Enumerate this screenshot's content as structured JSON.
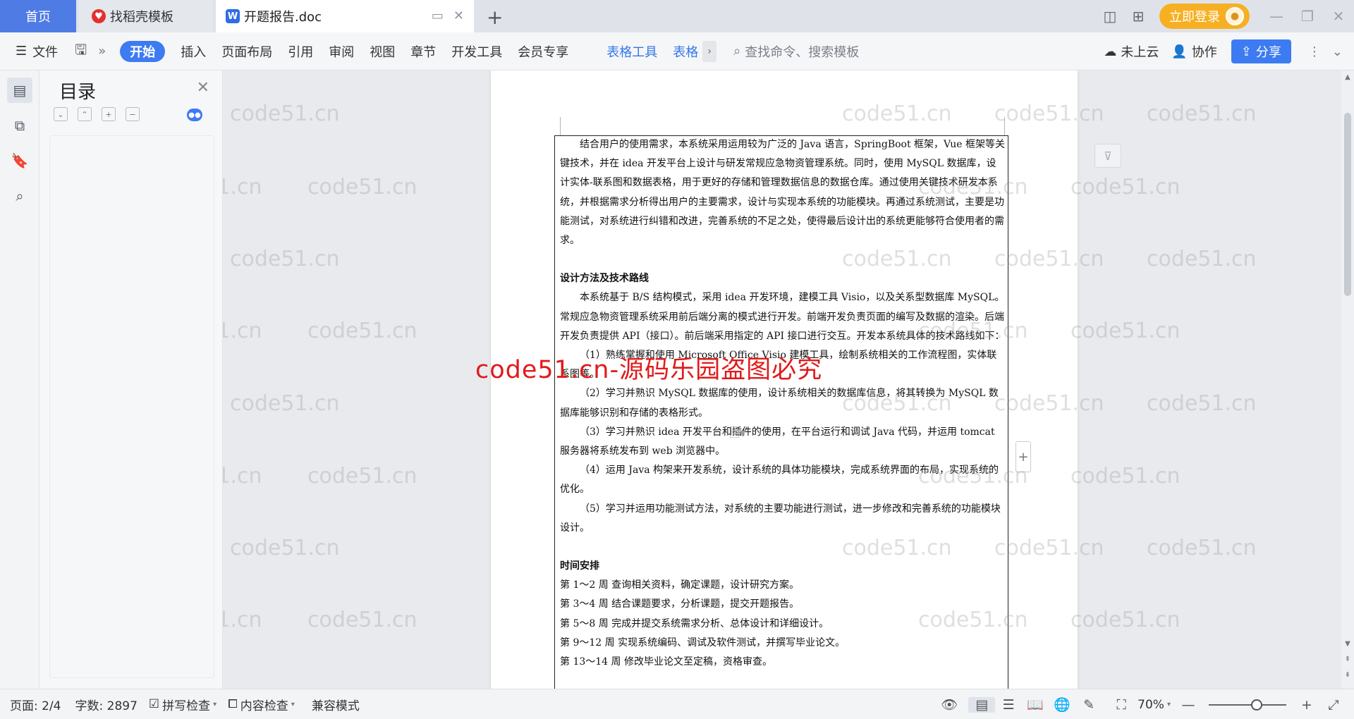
{
  "tabs": {
    "home": "首页",
    "zhaodaoke": "找稻壳模板",
    "doc": "开题报告.doc"
  },
  "topbar": {
    "login": "立即登录"
  },
  "ribbon": {
    "file": "文件",
    "start": "开始",
    "tabs": [
      "插入",
      "页面布局",
      "引用",
      "审阅",
      "视图",
      "章节",
      "开发工具",
      "会员专享"
    ],
    "table_tools": "表格工具",
    "table_style": "表格",
    "search": "查找命令、搜索模板",
    "cloud": "未上云",
    "collab": "协作",
    "share": "分享"
  },
  "toc": {
    "title": "目录"
  },
  "document": {
    "para1": "结合用户的使用需求，本系统采用运用较为广泛的 Java 语言，SpringBoot 框架，Vue 框架等关键技术，并在 idea 开发平台上设计与研发常规应急物资管理系统。同时，使用 MySQL 数据库，设计实体-联系图和数据表格，用于更好的存储和管理数据信息的数据仓库。通过使用关键技术研发本系统，并根据需求分析得出用户的主要需求，设计与实现本系统的功能模块。再通过系统测试，主要是功能测试，对系统进行纠错和改进，完善系统的不足之处，使得最后设计出的系统更能够符合使用者的需求。",
    "heading_method": "设计方法及技术路线",
    "para2": "本系统基于 B/S 结构模式，采用 idea 开发环境，建模工具 Visio，以及关系型数据库 MySQL。常规应急物资管理系统采用前后端分离的模式进行开发。前端开发负责页面的编写及数据的渲染。后端开发负责提供 API（接口）。前后端采用指定的 API 接口进行交互。开发本系统具体的技术路线如下：",
    "steps": [
      "（1）熟练掌握和使用 Microsoft Office Visio 建模工具，绘制系统相关的工作流程图，实体联系图等。",
      "（2）学习并熟识 MySQL 数据库的使用，设计系统相关的数据库信息，将其转换为 MySQL 数据库能够识别和存储的表格形式。",
      "（3）学习并熟识 idea 开发平台和插件的使用，在平台运行和调试 Java 代码，并运用 tomcat 服务器将系统发布到 web 浏览器中。",
      "（4）运用 Java 构架来开发系统，设计系统的具体功能模块，完成系统界面的布局，实现系统的优化。",
      "（5）学习并运用功能测试方法，对系统的主要功能进行测试，进一步修改和完善系统的功能模块设计。"
    ],
    "heading_schedule": "时间安排",
    "schedule": [
      "第 1～2 周 查询相关资料，确定课题，设计研究方案。",
      "第 3～4 周 结合课题要求，分析课题，提交开题报告。",
      "第 5～8 周 完成并提交系统需求分析、总体设计和详细设计。",
      "第 9～12 周 实现系统编码、调试及软件测试，并撰写毕业论文。",
      "第 13～14 周 修改毕业论文至定稿，资格审查。"
    ]
  },
  "watermark": {
    "repeat": "code51.cn",
    "red": "code51.cn-源码乐园盗图必究"
  },
  "statusbar": {
    "page": "页面: 2/4",
    "words": "字数: 2897",
    "spell": "拼写检查",
    "content_check": "内容检查",
    "compat": "兼容模式",
    "zoom": "70%"
  },
  "colors": {
    "accent": "#3d7bf2",
    "login": "#f7b023",
    "home_tab": "#4f7be4",
    "red_watermark": "#e11a1a"
  }
}
